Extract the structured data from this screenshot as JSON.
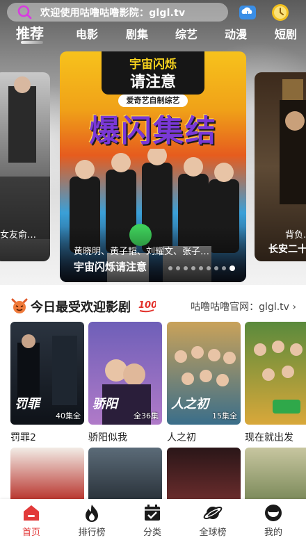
{
  "search": {
    "text": "欢迎使用咕噜咕噜影院：glgl.tv"
  },
  "top_icons": [
    "cloud-download-icon",
    "clock-icon"
  ],
  "tabs": [
    {
      "label": "推荐",
      "active": true
    },
    {
      "label": "电影"
    },
    {
      "label": "剧集"
    },
    {
      "label": "综艺"
    },
    {
      "label": "动漫"
    },
    {
      "label": "短剧"
    }
  ],
  "carousel": {
    "left": {
      "caption": "女友俞…"
    },
    "main": {
      "poster_line1": "宇宙闪烁",
      "poster_line2": "请注意",
      "poster_tag": "爱奇艺自制综艺",
      "poster_big": "爆闪集结",
      "subtitle": "黄晓明、黄子韬、刘耀文、张子…",
      "title": "宇宙闪烁请注意",
      "dots_total": 9,
      "dots_active_index": 8
    },
    "right": {
      "caption": "背负…",
      "title": "长安二十"
    }
  },
  "section": {
    "title": "今日最受欢迎影剧",
    "more": "咕噜咕噜官网：glgl.tv ›"
  },
  "movies": [
    {
      "title": "罚罪2",
      "label": "40集全",
      "art": "罚罪",
      "color1": "#2b3440",
      "color2": "#0e1218"
    },
    {
      "title": "骄阳似我",
      "label": "全36集",
      "art": "骄阳",
      "color1": "#6e5fb8",
      "color2": "#b07ac8"
    },
    {
      "title": "人之初",
      "label": "15集全",
      "art": "人之初",
      "color1": "#c9a25a",
      "color2": "#3a6e8a"
    },
    {
      "title": "现在就出发",
      "label": "",
      "art": "",
      "color1": "#5a8a3c",
      "color2": "#d9a83a"
    }
  ],
  "row2_colors": [
    [
      "#b8332c",
      "#f2ece6"
    ],
    [
      "#5b6b78",
      "#2a323a"
    ],
    [
      "#6a2c2c",
      "#2a1618"
    ],
    [
      "#7c8a5a",
      "#c8c6a0"
    ]
  ],
  "nav": [
    {
      "label": "首页",
      "icon": "home-icon",
      "active": true
    },
    {
      "label": "排行榜",
      "icon": "fire-icon"
    },
    {
      "label": "分类",
      "icon": "calendar-check-icon"
    },
    {
      "label": "全球榜",
      "icon": "planet-icon"
    },
    {
      "label": "我的",
      "icon": "profile-icon"
    }
  ],
  "colors": {
    "accent": "#e23a3a",
    "search_icon": "#d83be0"
  }
}
